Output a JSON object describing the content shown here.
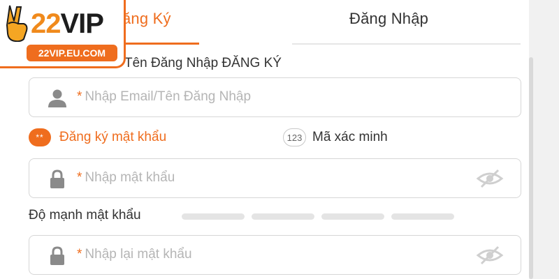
{
  "tabs": {
    "register": "ăng Ký",
    "login": "Đăng Nhập"
  },
  "section_label": "Tên Đăng Nhập ĐĂNG KÝ",
  "username_field": {
    "required_mark": "*",
    "placeholder": "Nhập Email/Tên Đăng Nhập",
    "icon": "user-icon"
  },
  "options": {
    "password_badge": "**",
    "password_label": "Đăng ký mật khẩu",
    "code_badge": "123",
    "code_label": "Mã xác minh"
  },
  "password_field": {
    "required_mark": "*",
    "placeholder": "Nhập mật khẩu",
    "icon": "lock-icon",
    "toggle_icon": "eye-hidden-icon"
  },
  "strength": {
    "label": "Độ mạnh mật khẩu",
    "filled_segments": 0,
    "total_segments": 4
  },
  "confirm_field": {
    "required_mark": "*",
    "placeholder": "Nhập lại mật khẩu",
    "icon": "lock-icon",
    "toggle_icon": "eye-hidden-icon"
  },
  "logo": {
    "number": "22",
    "brand": "VIP",
    "url": "22VIP.EU.COM"
  },
  "colors": {
    "accent": "#ef6d1e",
    "placeholder": "#b5b5b5",
    "border": "#d6d6d6",
    "strength_empty": "#e4e4e4"
  }
}
